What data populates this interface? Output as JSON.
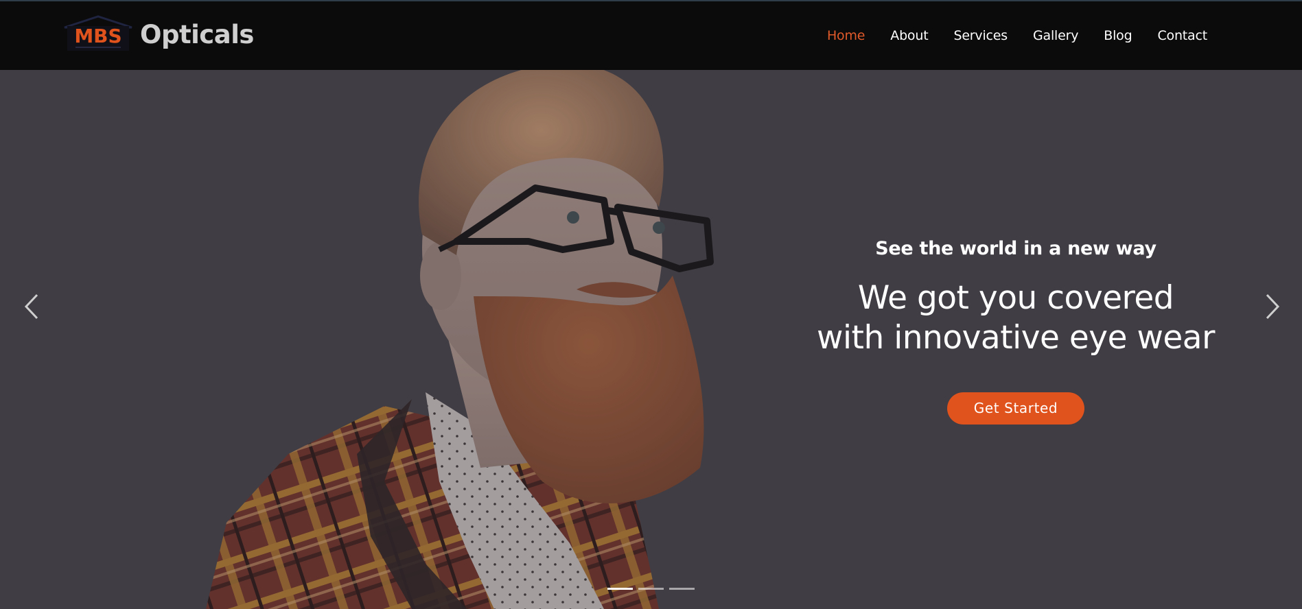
{
  "brand": {
    "logo_text": "MBS",
    "name": "Opticals",
    "logo_color": "#e0531c"
  },
  "nav": {
    "items": [
      {
        "label": "Home",
        "active": true
      },
      {
        "label": "About",
        "active": false
      },
      {
        "label": "Services",
        "active": false
      },
      {
        "label": "Gallery",
        "active": false
      },
      {
        "label": "Blog",
        "active": false
      },
      {
        "label": "Contact",
        "active": false
      }
    ],
    "active_color": "#e05a2a"
  },
  "hero": {
    "kicker": "See the world in a new way",
    "headline_line1": "We got you covered",
    "headline_line2": "with innovative eye wear",
    "cta_label": "Get Started",
    "cta_color": "#e0531c",
    "prev_icon": "chevron-left-icon",
    "next_icon": "chevron-right-icon",
    "slides_count": 3,
    "active_slide": 1
  }
}
